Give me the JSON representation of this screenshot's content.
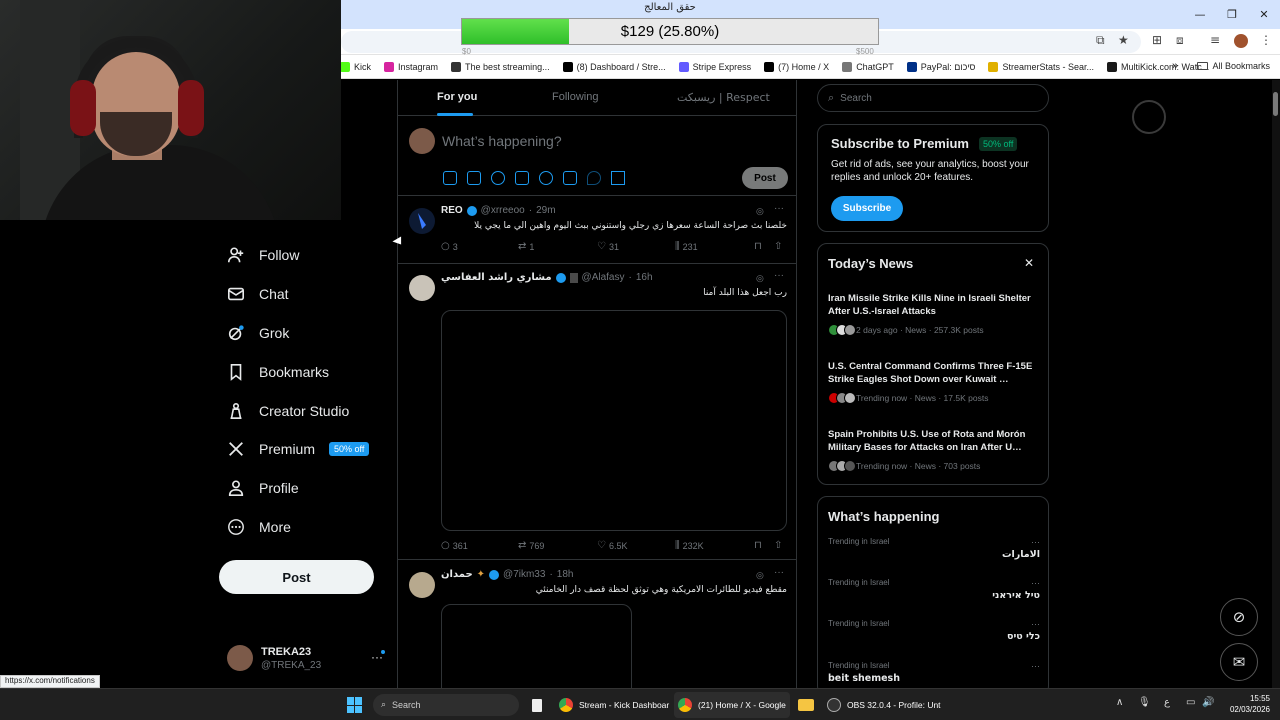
{
  "overlay": {
    "goal_title": "حقق المعالج",
    "goal_text": "$129 (25.80%)",
    "goal_progress": 0.258,
    "goal_min": "$0",
    "goal_max": "$500"
  },
  "browser": {
    "bookmarks": [
      {
        "label": "Kick",
        "color": "#53fc18"
      },
      {
        "label": "Instagram",
        "color": "#d6249f"
      },
      {
        "label": "The best streaming...",
        "color": "#333333"
      },
      {
        "label": "(8) Dashboard / Stre...",
        "color": "#000000"
      },
      {
        "label": "Stripe Express",
        "color": "#635bff"
      },
      {
        "label": "(7) Home / X",
        "color": "#000000"
      },
      {
        "label": "ChatGPT",
        "color": "#777777"
      },
      {
        "label": "PayPal: סיכום",
        "color": "#003087"
      },
      {
        "label": "StreamerStats - Sear...",
        "color": "#e0b000"
      },
      {
        "label": "MultiKick.com: Watc...",
        "color": "#1a1a1a"
      }
    ],
    "all_bookmarks": "All Bookmarks",
    "status_url": "https://x.com/notifications"
  },
  "nav": {
    "items": [
      {
        "label": "Follow",
        "icon": "add-person-icon"
      },
      {
        "label": "Chat",
        "icon": "mail-icon"
      },
      {
        "label": "Grok",
        "icon": "grok-icon"
      },
      {
        "label": "Bookmarks",
        "icon": "bookmark-icon"
      },
      {
        "label": "Creator Studio",
        "icon": "creator-studio-icon"
      },
      {
        "label": "Premium",
        "icon": "x-logo-icon",
        "badge": "50% off"
      },
      {
        "label": "Profile",
        "icon": "person-icon"
      },
      {
        "label": "More",
        "icon": "more-circle-icon"
      }
    ],
    "post_label": "Post",
    "account": {
      "name": "TREKA23",
      "handle": "@TREKA_23"
    }
  },
  "feed": {
    "tabs": [
      "For you",
      "Following",
      "ريسبكت | Respect"
    ],
    "composer_placeholder": "What’s happening?",
    "composer_post": "Post",
    "tweets": [
      {
        "name": "REO",
        "handle": "@xrreeoo",
        "time": "29m",
        "text": "خلصنا بث صراحة الساعة سعرها زي رجلي واستنوني ببث اليوم واهين الي ما يجي يلا",
        "replies": "3",
        "reposts": "1",
        "likes": "31",
        "views": "231"
      },
      {
        "name": "مشاري راشد العفاسي",
        "handle": "@Alafasy",
        "time": "16h",
        "text": "رب اجعل هذا البلد آمنا",
        "replies": "361",
        "reposts": "769",
        "likes": "6.5K",
        "views": "232K"
      },
      {
        "name": "حمدان",
        "handle": "@7ikm33",
        "time": "18h",
        "text": "مقطع فيديو للطائرات الامريكية وهي توثق لحظة قصف دار الخامنئي"
      }
    ]
  },
  "sidebar": {
    "search_placeholder": "Search",
    "premium": {
      "title": "Subscribe to Premium",
      "badge": "50% off",
      "desc": "Get rid of ads, see your analytics, boost your replies and unlock 20+ features.",
      "button": "Subscribe"
    },
    "news_title": "Today’s News",
    "news": [
      {
        "title": "Iran Missile Strike Kills Nine in Israeli Shelter After U.S.-Israel Attacks",
        "meta": "2 days ago · News · 257.3K posts"
      },
      {
        "title": "U.S. Central Command Confirms Three F-15E Strike Eagles Shot Down over Kuwait …",
        "meta": "Trending now · News · 17.5K posts"
      },
      {
        "title": "Spain Prohibits U.S. Use of Rota and Morón Military Bases for Attacks on Iran After U…",
        "meta": "Trending now · News · 703 posts"
      }
    ],
    "happening_title": "What’s happening",
    "trends": [
      {
        "context": "Trending in Israel",
        "name": "الامارات"
      },
      {
        "context": "Trending in Israel",
        "name": "טיל איראני"
      },
      {
        "context": "Trending in Israel",
        "name": "כלי טיס"
      },
      {
        "context": "Trending in Israel",
        "name": "beit shemesh"
      }
    ]
  },
  "taskbar": {
    "search": "Search",
    "apps": [
      {
        "label": "Stream - Kick Dashboar"
      },
      {
        "label": "(21) Home / X - Google"
      },
      {
        "label": "OBS 32.0.4 - Profile: Unt"
      }
    ],
    "lang": "ع",
    "time": "15:55",
    "date": "02/03/2026"
  }
}
